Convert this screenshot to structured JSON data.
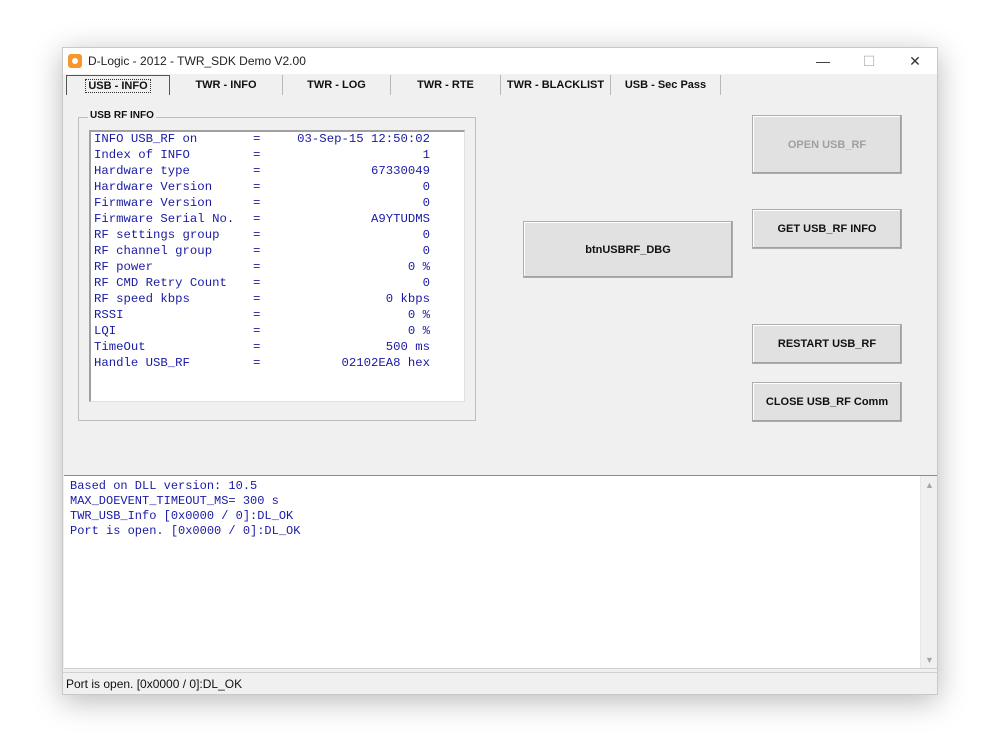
{
  "window": {
    "title": "D-Logic - 2012  - TWR_SDK Demo V2.00",
    "controls": {
      "minimize": "—",
      "maximize": "☐",
      "close": "✕"
    }
  },
  "tabs": [
    {
      "label": "USB - INFO",
      "active": true
    },
    {
      "label": "TWR - INFO"
    },
    {
      "label": "TWR - LOG"
    },
    {
      "label": "TWR - RTE"
    },
    {
      "label": "TWR - BLACKLIST"
    },
    {
      "label": "USB - Sec Pass"
    }
  ],
  "usb_rf_info": {
    "group_label": "USB RF INFO",
    "rows": [
      {
        "label": "INFO USB_RF on",
        "eq": "=",
        "value": "03-Sep-15 12:50:02"
      },
      {
        "label": "Index of INFO",
        "eq": "=",
        "value": "1"
      },
      {
        "label": "Hardware type",
        "eq": "=",
        "value": "67330049"
      },
      {
        "label": "Hardware Version",
        "eq": "=",
        "value": "0"
      },
      {
        "label": "Firmware Version",
        "eq": "=",
        "value": "0"
      },
      {
        "label": "Firmware Serial No.",
        "eq": "=",
        "value": "A9YTUDMS"
      },
      {
        "label": "RF settings group",
        "eq": "=",
        "value": "0"
      },
      {
        "label": "RF channel group",
        "eq": "=",
        "value": "0"
      },
      {
        "label": "RF power",
        "eq": "=",
        "value": "0 %"
      },
      {
        "label": "RF CMD Retry Count",
        "eq": "=",
        "value": "0"
      },
      {
        "label": "RF speed kbps",
        "eq": "=",
        "value": "0 kbps"
      },
      {
        "label": "RSSI",
        "eq": "=",
        "value": "0 %"
      },
      {
        "label": "LQI",
        "eq": "=",
        "value": "0 %"
      },
      {
        "label": "TimeOut",
        "eq": "=",
        "value": "500 ms"
      },
      {
        "label": "Handle USB_RF",
        "eq": "=",
        "value": "02102EA8 hex"
      }
    ]
  },
  "buttons": {
    "open": "OPEN USB_RF",
    "debug": "btnUSBRF_DBG",
    "get_info": "GET USB_RF INFO",
    "restart": "RESTART USB_RF",
    "close_comm": "CLOSE USB_RF Comm"
  },
  "log": {
    "lines": [
      "Based on DLL version: 10.5",
      "MAX_DOEVENT_TIMEOUT_MS= 300 s",
      "TWR_USB_Info [0x0000 / 0]:DL_OK",
      "Port is open. [0x0000 / 0]:DL_OK"
    ]
  },
  "status": {
    "text": "Port is open. [0x0000 / 0]:DL_OK"
  }
}
